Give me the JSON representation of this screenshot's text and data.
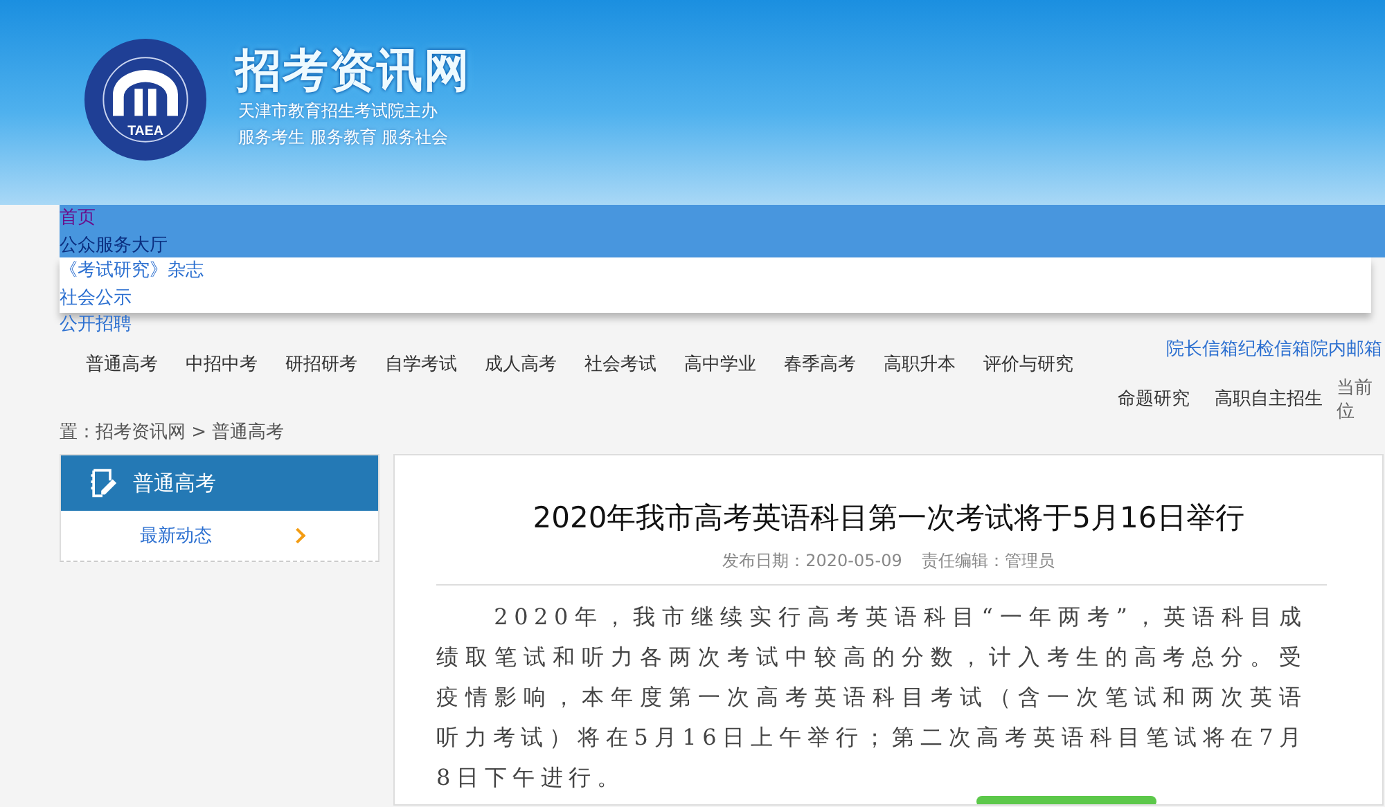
{
  "header": {
    "logo_text": "TAEA",
    "site_title": "招考资讯网",
    "subtitles": [
      "天津市教育招生考试院主办",
      "服务考生 服务教育 服务社会"
    ]
  },
  "top_links": [
    {
      "label": "首页",
      "visited": true
    },
    {
      "label": "公众服务大厅",
      "visited": false
    },
    {
      "label": "《考试研究》杂志",
      "visited": false
    },
    {
      "label": "社会公示",
      "visited": false
    },
    {
      "label": "公开招聘",
      "visited": false
    }
  ],
  "nav_items": [
    "普通高考",
    "中招中考",
    "研招研考",
    "自学考试",
    "成人高考",
    "社会考试",
    "高中学业",
    "春季高考",
    "高职升本",
    "评价与研究"
  ],
  "mailbox_links": "院长信箱纪检信箱院内邮箱",
  "nav_items_wrapped": [
    "命题研究",
    "高职自主招生"
  ],
  "breadcrumb_prefix": "当前位",
  "breadcrumb": "置：招考资讯网 > 普通高考",
  "sidebar": {
    "title": "普通高考",
    "items": [
      {
        "label": "最新动态"
      }
    ]
  },
  "article": {
    "title": "2020年我市高考英语科目第一次考试将于5月16日举行",
    "date": "发布日期：2020-05-09",
    "editor": "责任编辑：管理员",
    "body": "2020年，我市继续实行高考英语科目“一年两考”，英语科目成绩取笔试和听力各两次考试中较高的分数，计入考生的高考总分。受疫情影响，本年度第一次高考英语科目考试（含一次笔试和两次英语听力考试）将在5月16日上午举行；第二次高考英语科目笔试将在7月8日下午进行。"
  }
}
